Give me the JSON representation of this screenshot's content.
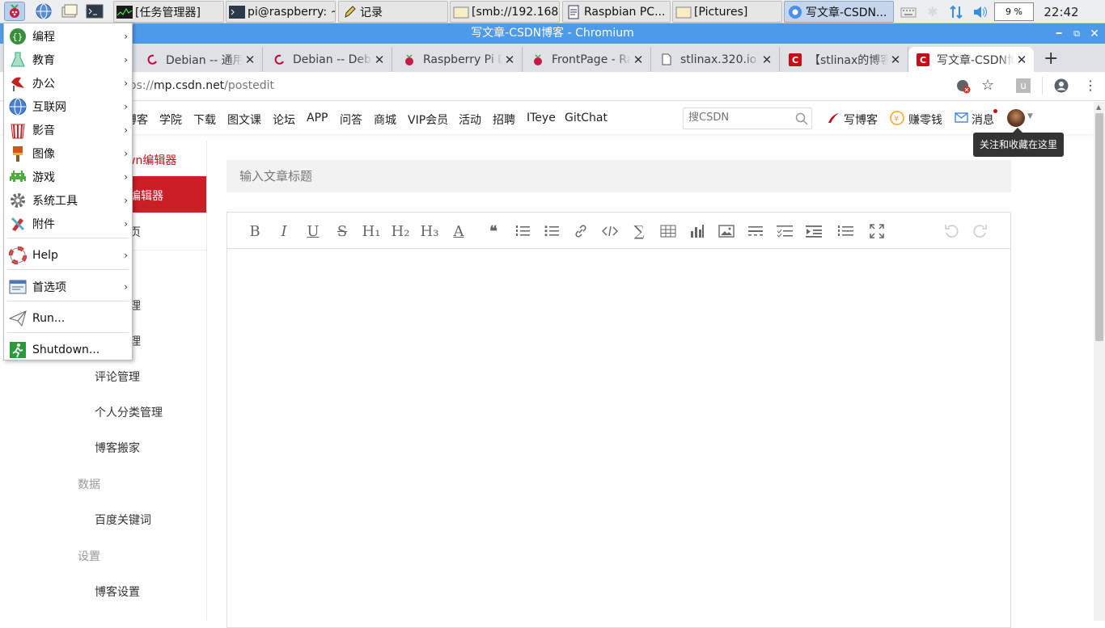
{
  "taskbar": {
    "tasks": [
      {
        "label": "[任务管理器]",
        "icon": "task-manager-icon"
      },
      {
        "label": "pi@raspberry: ~",
        "icon": "terminal-icon"
      },
      {
        "label": "记录",
        "icon": "pencil-icon"
      },
      {
        "label": "[smb://192.168...",
        "icon": "folder-icon"
      },
      {
        "label": "Raspbian PC...",
        "icon": "document-icon"
      },
      {
        "label": "[Pictures]",
        "icon": "folder-icon"
      },
      {
        "label": "写文章-CSDN...",
        "icon": "chromium-icon"
      }
    ],
    "cpu": "9 %",
    "clock": "22:42"
  },
  "window": {
    "title": "写文章-CSDN博客 - Chromium"
  },
  "tabs": [
    {
      "label": "Debian -- 通用操作系统"
    },
    {
      "label": "Debian -- Debian"
    },
    {
      "label": "Raspberry Pi Documentation"
    },
    {
      "label": "FrontPage - Raspbian"
    },
    {
      "label": "stlinax.320.io"
    },
    {
      "label": "【stlinax的博客】"
    },
    {
      "label": "写文章-CSDN博客"
    }
  ],
  "omnibox": {
    "url_prefix": "os://",
    "url_host": "mp.csdn.net",
    "url_path": "/postedit"
  },
  "nav": {
    "items": [
      "博客",
      "学院",
      "下载",
      "图文课",
      "论坛",
      "APP",
      "问答",
      "商城",
      "VIP会员",
      "活动",
      "招聘",
      "ITeye",
      "GitChat"
    ],
    "search_placeholder": "搜CSDN",
    "write": "写博客",
    "earn": "赚零钱",
    "messages": "消息",
    "tooltip": "关注和收藏在这里"
  },
  "sidebar": {
    "md_editor": "wn编辑器",
    "rich_editor": "编辑器",
    "item3": "页",
    "item4": "理",
    "item5": "理",
    "comment": "评论管理",
    "category": "个人分类管理",
    "move": "博客搬家",
    "group_data": "数据",
    "keywords": "百度关键词",
    "group_settings": "设置",
    "blog_settings": "博客设置"
  },
  "editor": {
    "title_placeholder": "输入文章标题",
    "toolbar": {
      "bold": "B",
      "italic": "I",
      "underline": "U",
      "strike": "S",
      "h1": "H₁",
      "h2": "H₂",
      "h3": "H₃",
      "color": "A",
      "quote": "❝"
    }
  },
  "menu": {
    "items": [
      {
        "label": "编程",
        "icon": "programming-icon",
        "submenu": true
      },
      {
        "label": "教育",
        "icon": "education-icon",
        "submenu": true
      },
      {
        "label": "办公",
        "icon": "office-icon",
        "submenu": true
      },
      {
        "label": "互联网",
        "icon": "internet-icon",
        "submenu": true
      },
      {
        "label": "影音",
        "icon": "media-icon",
        "submenu": true
      },
      {
        "label": "图像",
        "icon": "graphics-icon",
        "submenu": true
      },
      {
        "label": "游戏",
        "icon": "games-icon",
        "submenu": true
      },
      {
        "label": "系统工具",
        "icon": "system-tools-icon",
        "submenu": true
      },
      {
        "label": "附件",
        "icon": "accessories-icon",
        "submenu": true
      }
    ],
    "help": "Help",
    "prefs": "首选项",
    "run": "Run...",
    "shutdown": "Shutdown..."
  },
  "colors": {
    "csdn_red": "#ca0c16",
    "titlebar": "#4c9ae8"
  }
}
